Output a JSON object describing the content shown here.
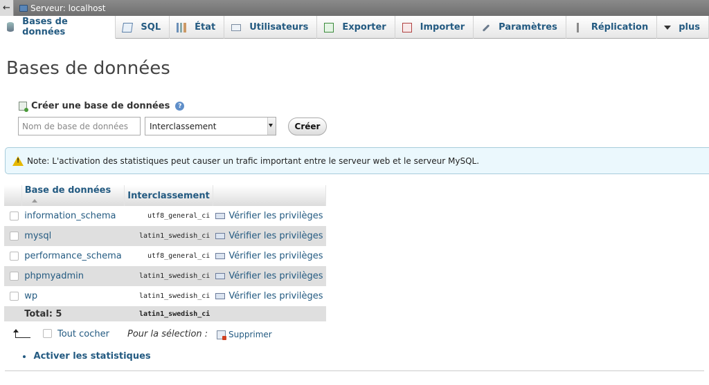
{
  "topbar": {
    "server_label": "Serveur: localhost"
  },
  "tabs": [
    {
      "label": "Bases de données",
      "icon": "database-icon"
    },
    {
      "label": "SQL",
      "icon": "sql-icon"
    },
    {
      "label": "État",
      "icon": "status-icon"
    },
    {
      "label": "Utilisateurs",
      "icon": "users-icon"
    },
    {
      "label": "Exporter",
      "icon": "export-icon"
    },
    {
      "label": "Importer",
      "icon": "import-icon"
    },
    {
      "label": "Paramètres",
      "icon": "wrench-icon"
    },
    {
      "label": "Réplication",
      "icon": "replication-icon"
    },
    {
      "label": "plus",
      "icon": "caret-down-icon"
    }
  ],
  "page_title": "Bases de données",
  "create": {
    "header": "Créer une base de données",
    "name_placeholder": "Nom de base de données",
    "collation_value": "Interclassement",
    "button_label": "Créer"
  },
  "notice": {
    "text": "Note: L'activation des statistiques peut causer un trafic important entre le serveur web et le serveur MySQL."
  },
  "table": {
    "headers": {
      "database": "Base de données",
      "collation": "Interclassement"
    },
    "rows": [
      {
        "name": "information_schema",
        "collation": "utf8_general_ci",
        "action": "Vérifier les privilèges"
      },
      {
        "name": "mysql",
        "collation": "latin1_swedish_ci",
        "action": "Vérifier les privilèges"
      },
      {
        "name": "performance_schema",
        "collation": "utf8_general_ci",
        "action": "Vérifier les privilèges"
      },
      {
        "name": "phpmyadmin",
        "collation": "latin1_swedish_ci",
        "action": "Vérifier les privilèges"
      },
      {
        "name": "wp",
        "collation": "latin1_swedish_ci",
        "action": "Vérifier les privilèges"
      }
    ],
    "total_label": "Total: 5",
    "total_collation": "latin1_swedish_ci"
  },
  "selection": {
    "check_all": "Tout cocher",
    "for_selection": "Pour la sélection :",
    "delete": "Supprimer"
  },
  "stats_link": "Activer les statistiques"
}
